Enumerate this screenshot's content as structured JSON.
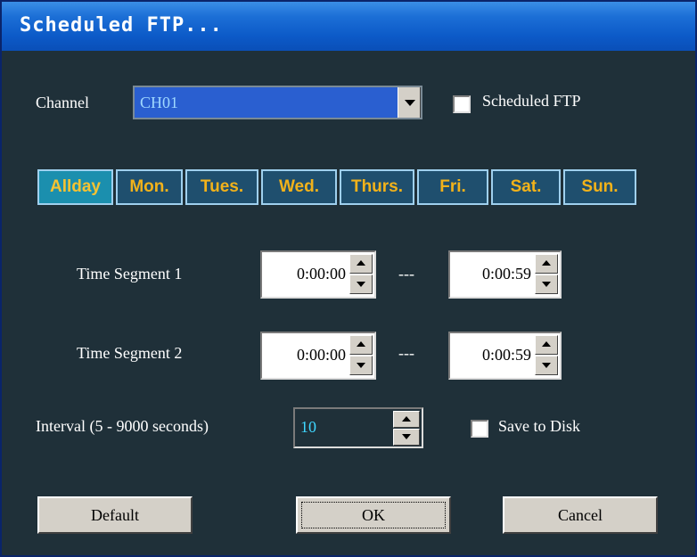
{
  "window": {
    "title": "Scheduled FTP..."
  },
  "channel": {
    "label": "Channel",
    "selected": "CH01"
  },
  "scheduled_ftp": {
    "label": "Scheduled FTP",
    "checked": false
  },
  "days": [
    {
      "label": "Allday",
      "active": true
    },
    {
      "label": "Mon.",
      "active": false
    },
    {
      "label": "Tues.",
      "active": false
    },
    {
      "label": "Wed.",
      "active": false
    },
    {
      "label": "Thurs.",
      "active": false
    },
    {
      "label": "Fri.",
      "active": false
    },
    {
      "label": "Sat.",
      "active": false
    },
    {
      "label": "Sun.",
      "active": false
    }
  ],
  "segments": [
    {
      "label": "Time Segment 1",
      "start": "0:00:00",
      "separator": "---",
      "end": "0:00:59"
    },
    {
      "label": "Time Segment 2",
      "start": "0:00:00",
      "separator": "---",
      "end": "0:00:59"
    }
  ],
  "interval": {
    "label": "Interval (5 - 9000 seconds)",
    "value": "10"
  },
  "save_to_disk": {
    "label": "Save to Disk",
    "checked": false
  },
  "buttons": {
    "default": "Default",
    "ok": "OK",
    "cancel": "Cancel"
  },
  "colors": {
    "title_bar": "#0c5ac8",
    "dialog_bg": "#1f3039",
    "day_text": "#f2b21a",
    "day_active_bg": "#1b8fae"
  },
  "icons": {
    "dropdown": "chevron-down-icon",
    "spin_up": "spin-up-icon",
    "spin_down": "spin-down-icon"
  }
}
